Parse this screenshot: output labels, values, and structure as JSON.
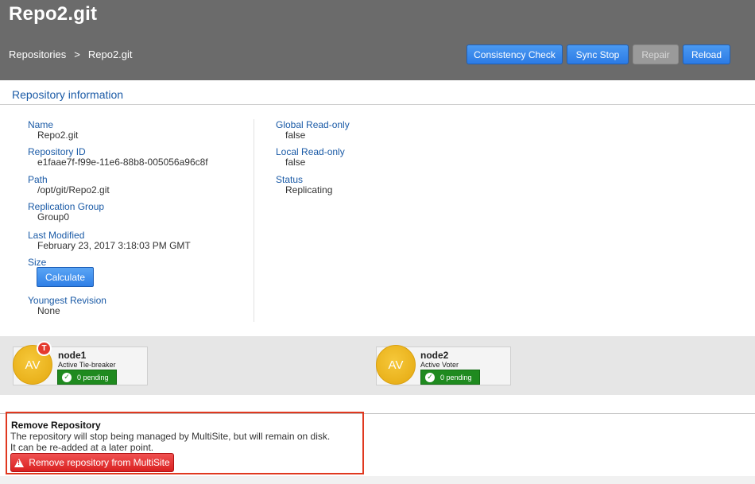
{
  "header": {
    "title": "Repo2.git",
    "breadcrumb": [
      "Repositories",
      ">",
      "Repo2.git"
    ],
    "buttons": {
      "consistency_check": "Consistency Check",
      "sync_stop": "Sync Stop",
      "repair": "Repair",
      "reload": "Reload"
    }
  },
  "section": {
    "title": "Repository information"
  },
  "info_left": [
    {
      "label": "Name",
      "value": "Repo2.git"
    },
    {
      "label": "Repository ID",
      "value": "e1faae7f-f99e-11e6-88b8-005056a96c8f"
    },
    {
      "label": "Path",
      "value": "/opt/git/Repo2.git"
    },
    {
      "label": "Replication Group",
      "value": "Group0"
    },
    {
      "label": "Last Modified",
      "value": "February 23, 2017 3:18:03 PM GMT"
    },
    {
      "label": "Size",
      "value": ""
    },
    {
      "label": "Youngest Revision",
      "value": "None"
    }
  ],
  "size_button": "Calculate",
  "info_right": [
    {
      "label": "Global Read-only",
      "value": "false"
    },
    {
      "label": "Local Read-only",
      "value": "false"
    },
    {
      "label": "Status",
      "value": "Replicating"
    }
  ],
  "nodes": [
    {
      "avatar": "AV",
      "badge": "T",
      "name": "node1",
      "role": "Active Tie-breaker",
      "pending": "0 pending"
    },
    {
      "avatar": "AV",
      "badge": "",
      "name": "node2",
      "role": "Active Voter",
      "pending": "0 pending"
    }
  ],
  "remove": {
    "title": "Remove Repository",
    "line1": "The repository will stop being managed by MultiSite, but will remain on disk.",
    "line2": "It can be re-added at a later point.",
    "button": "Remove repository from MultiSite"
  },
  "colors": {
    "header_bg": "#6b6b6b",
    "link_blue": "#1a5aa6",
    "primary_button": "#2c7be5",
    "danger": "#d92121",
    "success": "#1f8a1f",
    "avatar_yellow": "#f2b720"
  }
}
